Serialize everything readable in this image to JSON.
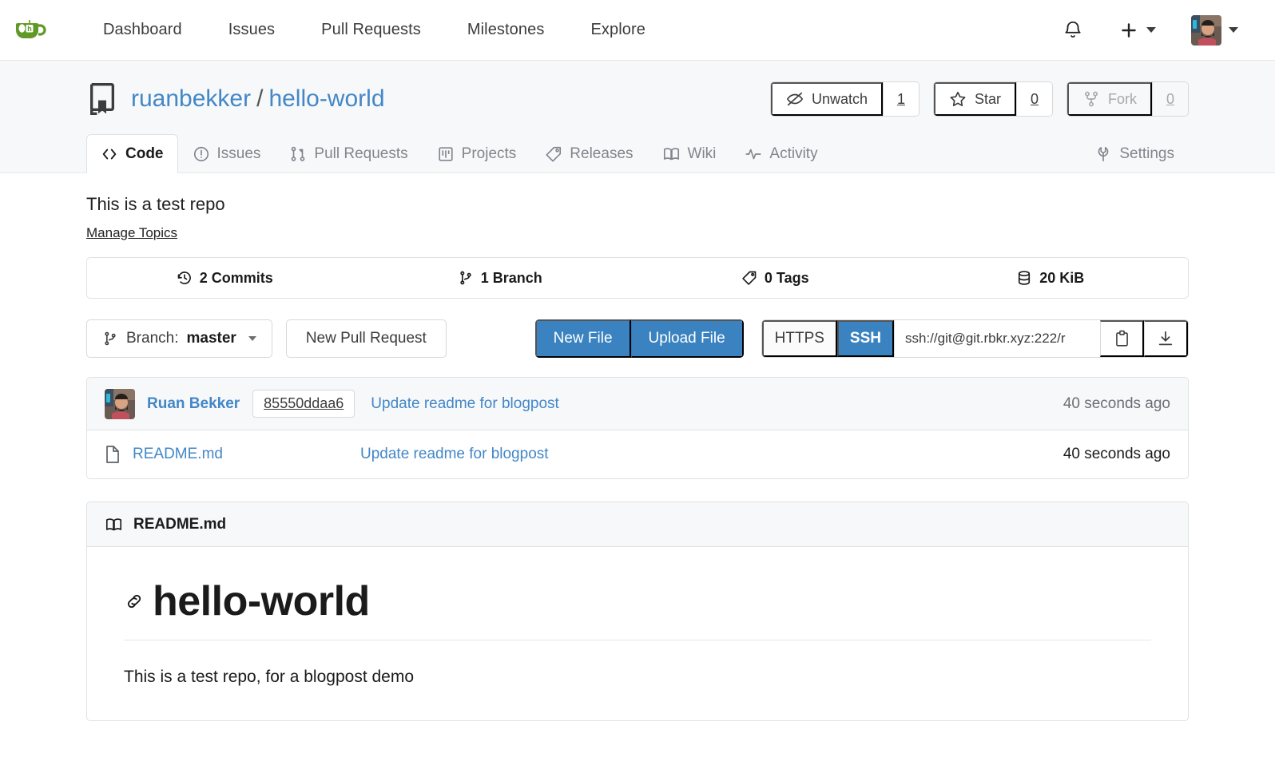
{
  "navbar": {
    "logo_name": "gitea-logo",
    "links": [
      {
        "label": "Dashboard",
        "name": "nav-link-dashboard"
      },
      {
        "label": "Issues",
        "name": "nav-link-issues"
      },
      {
        "label": "Pull Requests",
        "name": "nav-link-pull-requests"
      },
      {
        "label": "Milestones",
        "name": "nav-link-milestones"
      },
      {
        "label": "Explore",
        "name": "nav-link-explore"
      }
    ],
    "bell_icon": "bell-icon",
    "plus_icon": "plus-icon",
    "avatar": "user-avatar"
  },
  "repo": {
    "owner": "ruanbekker",
    "separator": "/",
    "name": "hello-world",
    "description": "This is a test repo",
    "manage_topics": "Manage Topics"
  },
  "repo_actions": {
    "watch_label": "Unwatch",
    "watch_count": "1",
    "star_label": "Star",
    "star_count": "0",
    "fork_label": "Fork",
    "fork_count": "0"
  },
  "tabs": [
    {
      "label": "Code",
      "icon": "code-icon",
      "active": true
    },
    {
      "label": "Issues",
      "icon": "issue-opened-icon",
      "active": false
    },
    {
      "label": "Pull Requests",
      "icon": "git-pull-request-icon",
      "active": false
    },
    {
      "label": "Projects",
      "icon": "project-icon",
      "active": false
    },
    {
      "label": "Releases",
      "icon": "tag-icon",
      "active": false
    },
    {
      "label": "Wiki",
      "icon": "book-icon",
      "active": false
    },
    {
      "label": "Activity",
      "icon": "pulse-icon",
      "active": false
    },
    {
      "label": "Settings",
      "icon": "wrench-icon",
      "active": false
    }
  ],
  "stats": [
    {
      "label": "2 Commits",
      "icon": "history-icon"
    },
    {
      "label": "1 Branch",
      "icon": "git-branch-icon"
    },
    {
      "label": "0 Tags",
      "icon": "tag-icon"
    },
    {
      "label": "20 KiB",
      "icon": "database-icon"
    }
  ],
  "toolbar": {
    "branch_prefix": "Branch:",
    "branch_name": "master",
    "new_pull_request": "New Pull Request",
    "new_file": "New File",
    "upload_file": "Upload File",
    "proto_https": "HTTPS",
    "proto_ssh": "SSH",
    "clone_url": "ssh://git@git.rbkr.xyz:222/r",
    "copy_icon": "clipboard-icon",
    "download_icon": "download-icon"
  },
  "latest_commit": {
    "author": "Ruan Bekker",
    "sha": "85550ddaa6",
    "message": "Update readme for blogpost",
    "time": "40 seconds ago"
  },
  "files": [
    {
      "name": "README.md",
      "icon": "file-icon",
      "commit_message": "Update readme for blogpost",
      "time": "40 seconds ago"
    }
  ],
  "readme": {
    "title": "README.md",
    "icon": "book-icon",
    "heading": "hello-world",
    "anchor_icon": "link-icon",
    "paragraph": "This is a test repo, for a blogpost demo"
  },
  "colors": {
    "brand_green": "#609926",
    "link_blue": "#4387c7",
    "primary_blue": "#3b83c0",
    "header_bg": "#f7f8f9",
    "border": "#dfe1e3",
    "muted": "#80868d"
  }
}
